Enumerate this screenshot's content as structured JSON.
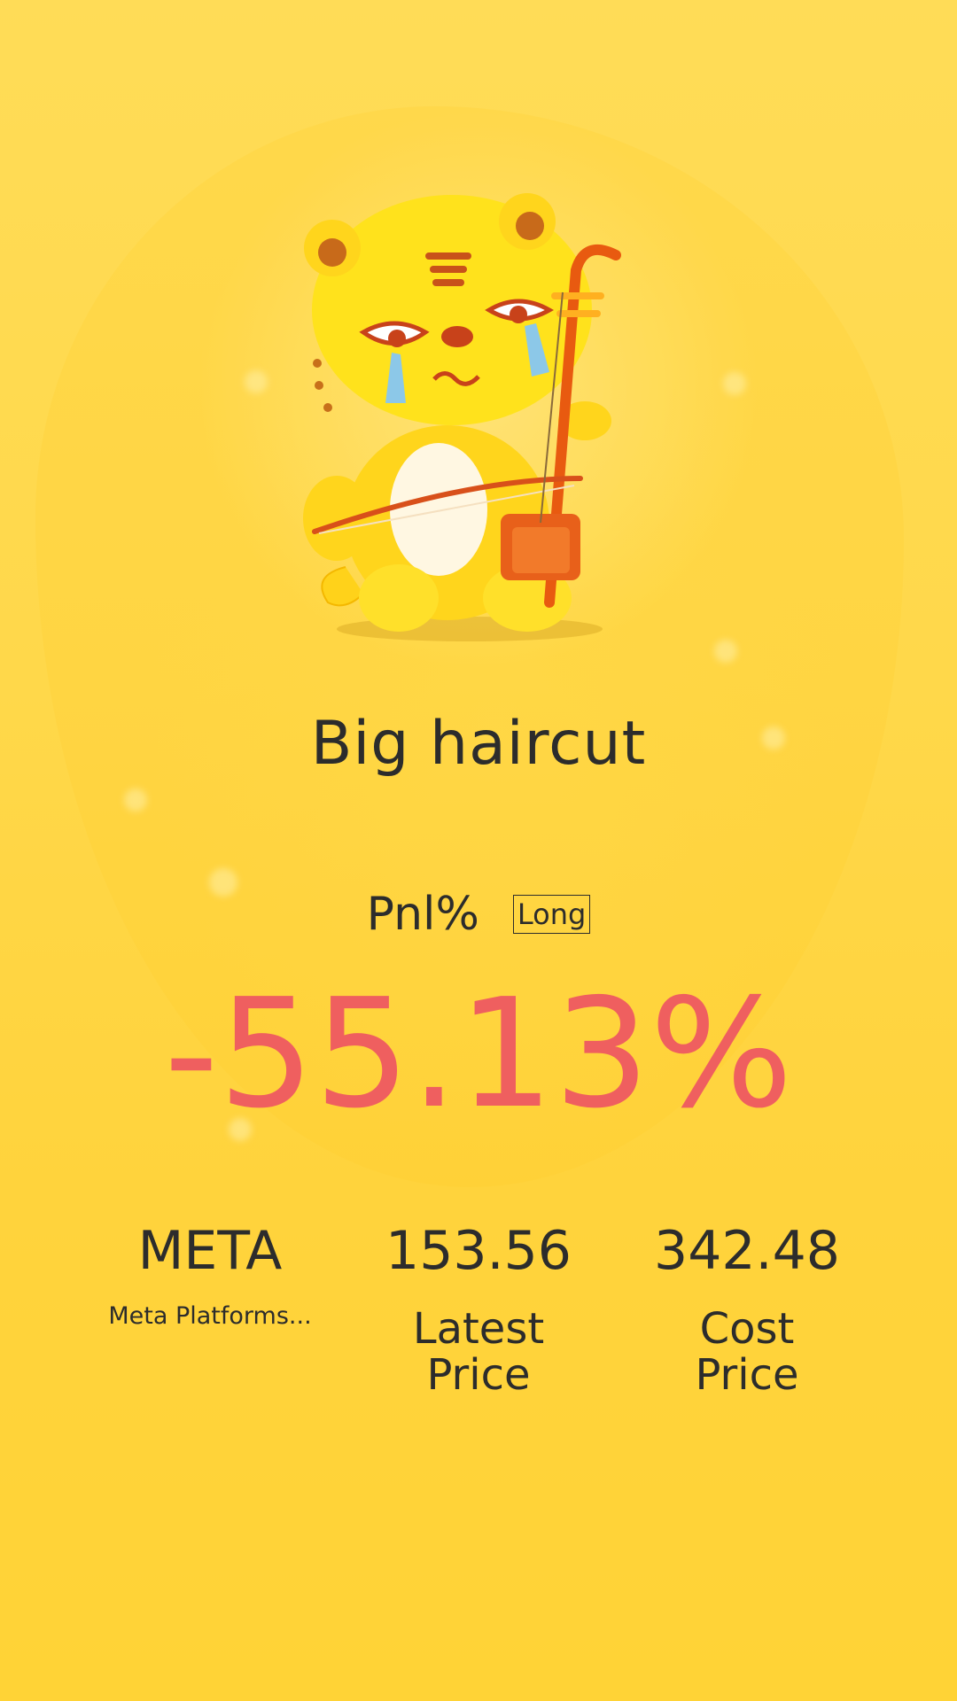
{
  "result": {
    "headline": "Big haircut",
    "pnl_label": "Pnl%",
    "position_badge": "Long",
    "pnl_value": "-55.13%"
  },
  "stock": {
    "ticker": "META",
    "name": "Meta Platforms...",
    "latest_price": "153.56",
    "latest_price_label_line1": "Latest",
    "latest_price_label_line2": "Price",
    "cost_price": "342.48",
    "cost_price_label_line1": "Cost",
    "cost_price_label_line2": "Price"
  },
  "colors": {
    "background": "#ffd53a",
    "loss": "#ef5f5f",
    "text": "#2c2c2c"
  },
  "icons": {
    "mascot": "crying-tiger-erhu-illustration"
  }
}
